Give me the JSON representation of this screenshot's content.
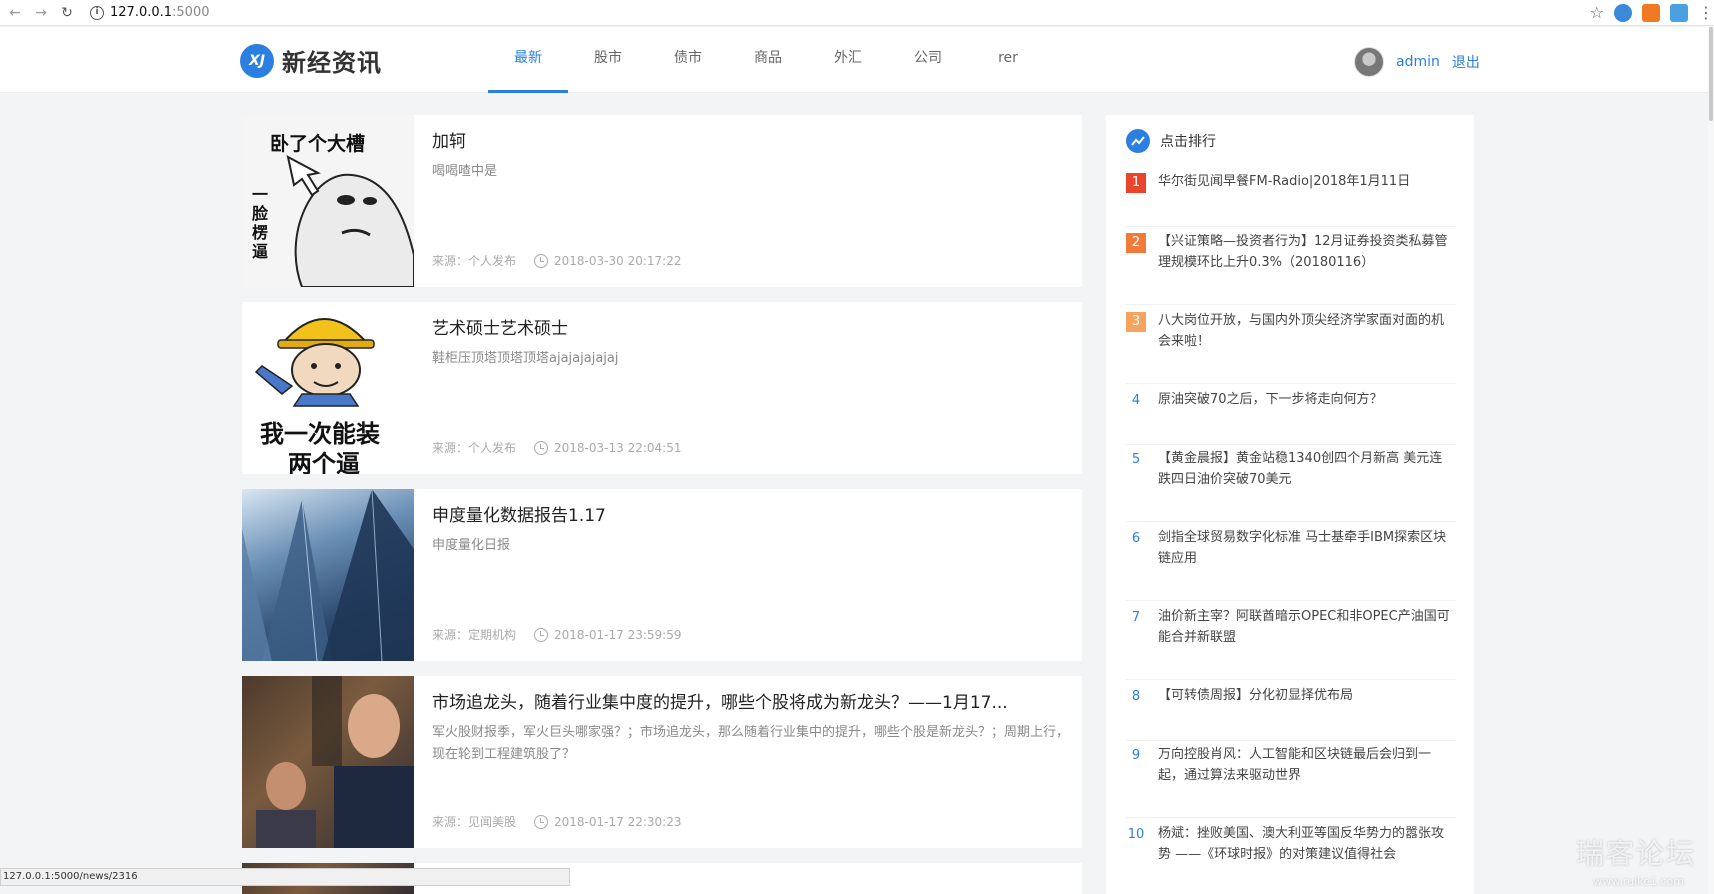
{
  "browser": {
    "url_host": "127.0.0.1",
    "url_port": ":5000",
    "status_url": "127.0.0.1:5000/news/2316"
  },
  "site": {
    "logo_mark": "XJ",
    "logo_text": "新经资讯"
  },
  "nav": {
    "tabs": [
      "最新",
      "股市",
      "债市",
      "商品",
      "外汇",
      "公司",
      "rer"
    ],
    "active": 0
  },
  "user": {
    "name": "admin",
    "logout": "退出"
  },
  "news": [
    {
      "title": "加轲",
      "summary": "喝喝喳中是",
      "source": "来源：个人发布",
      "time": "2018-03-30 20:17:22",
      "thumb_caption_top": "卧了个大槽",
      "thumb_caption_side": "一脸楞逼"
    },
    {
      "title": "艺术硕士艺术硕士",
      "summary": "鞋柜压顶塔顶塔顶塔ajajajajajaj",
      "source": "来源：个人发布",
      "time": "2018-03-13 22:04:51",
      "thumb_caption_top": "我一次能装",
      "thumb_caption_bottom": "两个逼"
    },
    {
      "title": "申度量化数据报告1.17",
      "summary": "申度量化日报",
      "source": "来源：定期机构",
      "time": "2018-01-17 23:59:59"
    },
    {
      "title": "市场追龙头，随着行业集中度的提升，哪些个股将成为新龙头？——1月17...",
      "summary": "军火股财报季，军火巨头哪家强？；市场追龙头，那么随着行业集中的提升，哪些个股是新龙头？；周期上行，现在轮到工程建筑股了？",
      "source": "来源：见闻美股",
      "time": "2018-01-17 22:30:23"
    }
  ],
  "sidebar": {
    "title": "点击排行",
    "items": [
      {
        "num": "1",
        "text": "华尔街见闻早餐FM-Radio|2018年1月11日"
      },
      {
        "num": "2",
        "text": "【兴证策略—投资者行为】12月证券投资类私募管理规模环比上升0.3%（20180116）"
      },
      {
        "num": "3",
        "text": "八大岗位开放，与国内外顶尖经济学家面对面的机会来啦！"
      },
      {
        "num": "4",
        "text": "原油突破70之后，下一步将走向何方？"
      },
      {
        "num": "5",
        "text": "【黄金晨报】黄金站稳1340创四个月新高 美元连跌四日油价突破70美元"
      },
      {
        "num": "6",
        "text": "剑指全球贸易数字化标准 马士基牵手IBM探索区块链应用"
      },
      {
        "num": "7",
        "text": "油价新主宰？阿联酋暗示OPEC和非OPEC产油国可能合并新联盟"
      },
      {
        "num": "8",
        "text": "【可转债周报】分化初显择优布局"
      },
      {
        "num": "9",
        "text": "万向控股肖风：人工智能和区块链最后会归到一起，通过算法来驱动世界"
      },
      {
        "num": "10",
        "text": "杨斌：挫败美国、澳大利亚等国反华势力的嚣张攻势 ——《环球时报》的对策建议值得社会"
      }
    ]
  },
  "watermark": {
    "text": "瑞客论坛",
    "url": "www.ruike1.com"
  },
  "colors": {
    "accent": "#2a7fe0",
    "rank1": "#e8452c",
    "rank2": "#f07a3a",
    "rank3": "#f5a35e"
  }
}
